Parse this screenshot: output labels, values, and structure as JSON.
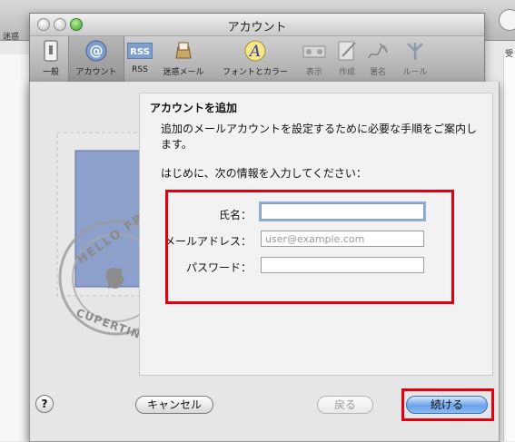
{
  "background": {
    "left_text": "迷惑",
    "right_text": "受"
  },
  "window": {
    "title": "アカウント"
  },
  "toolbar": {
    "items": [
      {
        "label": "一般",
        "icon": "switch-icon"
      },
      {
        "label": "アカウント",
        "icon": "at-icon",
        "selected": true
      },
      {
        "label": "RSS",
        "icon": "rss-icon",
        "icon_text": "RSS"
      },
      {
        "label": "迷惑メール",
        "icon": "junk-mail-icon"
      },
      {
        "label": "フォントとカラー",
        "icon": "font-icon",
        "icon_text": "A"
      },
      {
        "label": "表示",
        "icon": "view-icon"
      },
      {
        "label": "作成",
        "icon": "compose-icon"
      },
      {
        "label": "署名",
        "icon": "signature-icon"
      },
      {
        "label": "ルール",
        "icon": "rules-icon"
      }
    ]
  },
  "sheet": {
    "title": "アカウントを追加",
    "description": "追加のメールアカウントを設定するために必要な手順をご案内します。",
    "intro": "はじめに、次の情報を入力してください：",
    "fields": {
      "name_label": "氏名：",
      "name_value": "",
      "email_label": "メールアドレス：",
      "email_placeholder": "user@example.com",
      "password_label": "パスワード：",
      "password_value": ""
    },
    "stamp_text_top": "HELLO FR",
    "stamp_text_bottom": "CUPERTINO CA",
    "buttons": {
      "help": "?",
      "cancel": "キャンセル",
      "back": "戻る",
      "continue": "続ける"
    }
  },
  "colors": {
    "highlight": "#e0000f",
    "default_button": "#6aa3e8"
  }
}
